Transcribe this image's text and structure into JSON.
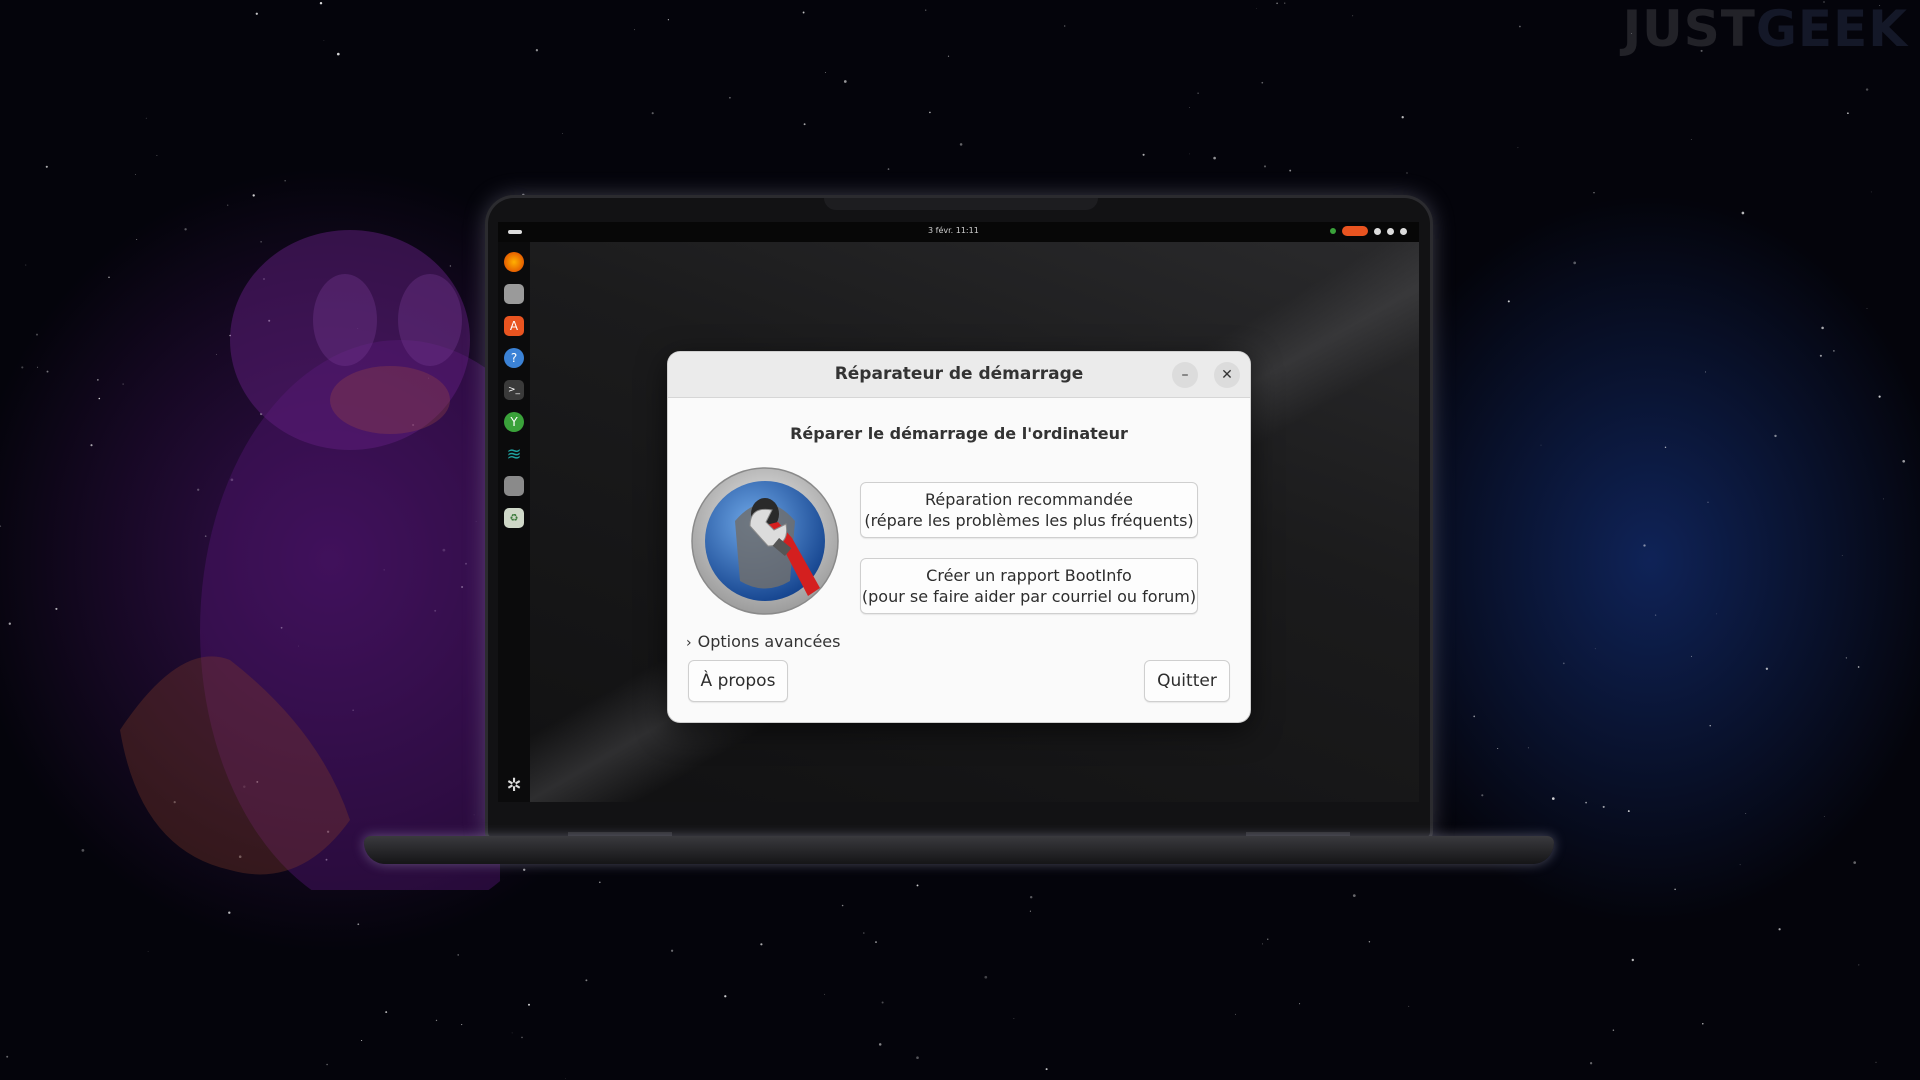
{
  "watermark": {
    "part1": "JUST",
    "part2": "GEEK"
  },
  "topbar": {
    "clock": "3 févr. 11:11"
  },
  "dock": {
    "items": [
      {
        "icon": "firefox-icon",
        "color": "#e66000"
      },
      {
        "icon": "files-icon",
        "color": "#9a9a9a"
      },
      {
        "icon": "app-center-icon",
        "color": "#e95420"
      },
      {
        "icon": "help-icon",
        "color": "#3b82d6"
      },
      {
        "icon": "terminal-icon",
        "color": "#3a3a3a"
      },
      {
        "icon": "boot-repair-icon",
        "color": "#3aa23a"
      },
      {
        "icon": "waves-icon",
        "color": "#1fa3a0"
      },
      {
        "icon": "drive-icon",
        "color": "#8a8a8a"
      },
      {
        "icon": "trash-icon",
        "color": "#7fb35b"
      }
    ]
  },
  "dialog": {
    "title": "Réparateur de démarrage",
    "minimize": "–",
    "close": "✕",
    "heading": "Réparer le démarrage de l'ordinateur",
    "recommended_repair": {
      "line1": "Réparation recommandée",
      "line2": "(répare les problèmes les plus fréquents)"
    },
    "bootinfo": {
      "line1": "Créer un rapport BootInfo",
      "line2": "(pour se faire aider par courriel ou forum)"
    },
    "advanced_options": "Options avancées",
    "about": "À propos",
    "quit": "Quitter"
  }
}
